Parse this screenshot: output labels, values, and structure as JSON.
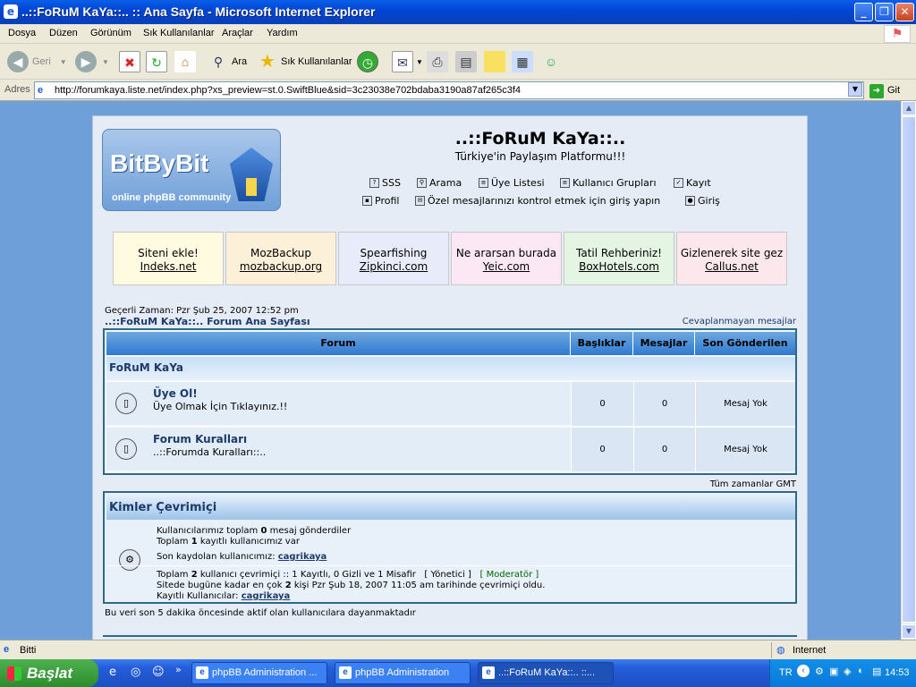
{
  "window": {
    "title": "..::FoRuM KaYa::.. :: Ana Sayfa - Microsoft Internet Explorer"
  },
  "menu": [
    "Dosya",
    "Düzen",
    "Görünüm",
    "Sık Kullanılanlar",
    "Araçlar",
    "Yardım"
  ],
  "toolbar": {
    "back": "Geri",
    "search": "Ara",
    "favorites": "Sık Kullanılanlar"
  },
  "address": {
    "label": "Adres",
    "url": "http://forumkaya.liste.net/index.php?xs_preview=st.0.SwiftBlue&sid=3c23038e702bdaba3190a87af265c3f4",
    "go": "Git"
  },
  "site": {
    "logo_text": "BitByBit",
    "logo_sub": "online phpBB community",
    "title": "..::FoRuM KaYa::..",
    "desc": "Türkiye'in Paylaşım Platformu!!!",
    "nav1": [
      "SSS",
      "Arama",
      "Üye Listesi",
      "Kullanıcı Grupları",
      "Kayıt"
    ],
    "nav2": [
      "Profil",
      "Özel mesajlarınızı kontrol etmek için giriş yapın",
      "Giriş"
    ]
  },
  "ads": [
    {
      "t": "Siteni ekle!",
      "u": "Indeks.net",
      "bg": "#fffbe0"
    },
    {
      "t": "MozBackup",
      "u": "mozbackup.org",
      "bg": "#fdf0d8"
    },
    {
      "t": "Spearfishing",
      "u": "Zipkinci.com",
      "bg": "#e8ecfa"
    },
    {
      "t": "Ne ararsan burada",
      "u": "Yeic.com",
      "bg": "#fbe8f4"
    },
    {
      "t": "Tatil Rehberiniz!",
      "u": "BoxHotels.com",
      "bg": "#e4f5e4"
    },
    {
      "t": "Gizlenerek site gez",
      "u": "Callus.net",
      "bg": "#fce8ec"
    }
  ],
  "forum": {
    "current_time": "Geçerli Zaman: Pzr Şub 25, 2007 12:52 pm",
    "index": "..::FoRuM KaYa::.. Forum Ana Sayfası",
    "unanswered": "Cevaplanmayan mesajlar",
    "headers": [
      "Forum",
      "Başlıklar",
      "Mesajlar",
      "Son Gönderilen"
    ],
    "category": "FoRuM KaYa",
    "rows": [
      {
        "title": "Üye Ol!",
        "desc": "Üye Olmak İçin Tıklayınız.!!",
        "topics": "0",
        "posts": "0",
        "last": "Mesaj Yok"
      },
      {
        "title": "Forum Kuralları",
        "desc": "..::Forumda Kuralları::..",
        "topics": "0",
        "posts": "0",
        "last": "Mesaj Yok"
      }
    ],
    "timezone": "Tüm zamanlar GMT"
  },
  "online": {
    "header": "Kimler Çevrimiçi",
    "l1a": "Kullanıcılarımız toplam ",
    "l1b": "0",
    "l1c": " mesaj gönderdiler",
    "l2a": "Toplam ",
    "l2b": "1",
    "l2c": " kayıtlı kullanıcımız var",
    "l3a": "Son kaydolan kullanıcımız: ",
    "l3b": "cagrikaya",
    "l4a": "Toplam ",
    "l4b": "2",
    "l4c": " kullanıcı çevrimiçi :: 1 Kayıtlı, 0 Gizli ve 1 Misafir",
    "admin": "[ Yönetici ]",
    "mod": "[ Moderatör ]",
    "l5a": "Sitede bugüne kadar en çok ",
    "l5b": "2",
    "l5c": " kişi Pzr Şub 18, 2007 11:05 am tarihinde çevrimiçi oldu.",
    "l6a": "Kayıtlı Kullanıcılar: ",
    "l6b": "cagrikaya",
    "note": "Bu veri son 5 dakika öncesinde aktif olan kullanıcılara dayanmaktadır"
  },
  "status": {
    "left": "Bitti",
    "zone": "Internet"
  },
  "taskbar": {
    "start": "Başlat",
    "tasks": [
      "phpBB Administration ...",
      "phpBB Administration",
      "..::FoRuM KaYa::.. ::..."
    ],
    "lang": "TR",
    "clock": "14:53"
  },
  "colors": {
    "accent": "#2f7ad0",
    "link": "#1d3a6b",
    "moderator": "#006600"
  }
}
